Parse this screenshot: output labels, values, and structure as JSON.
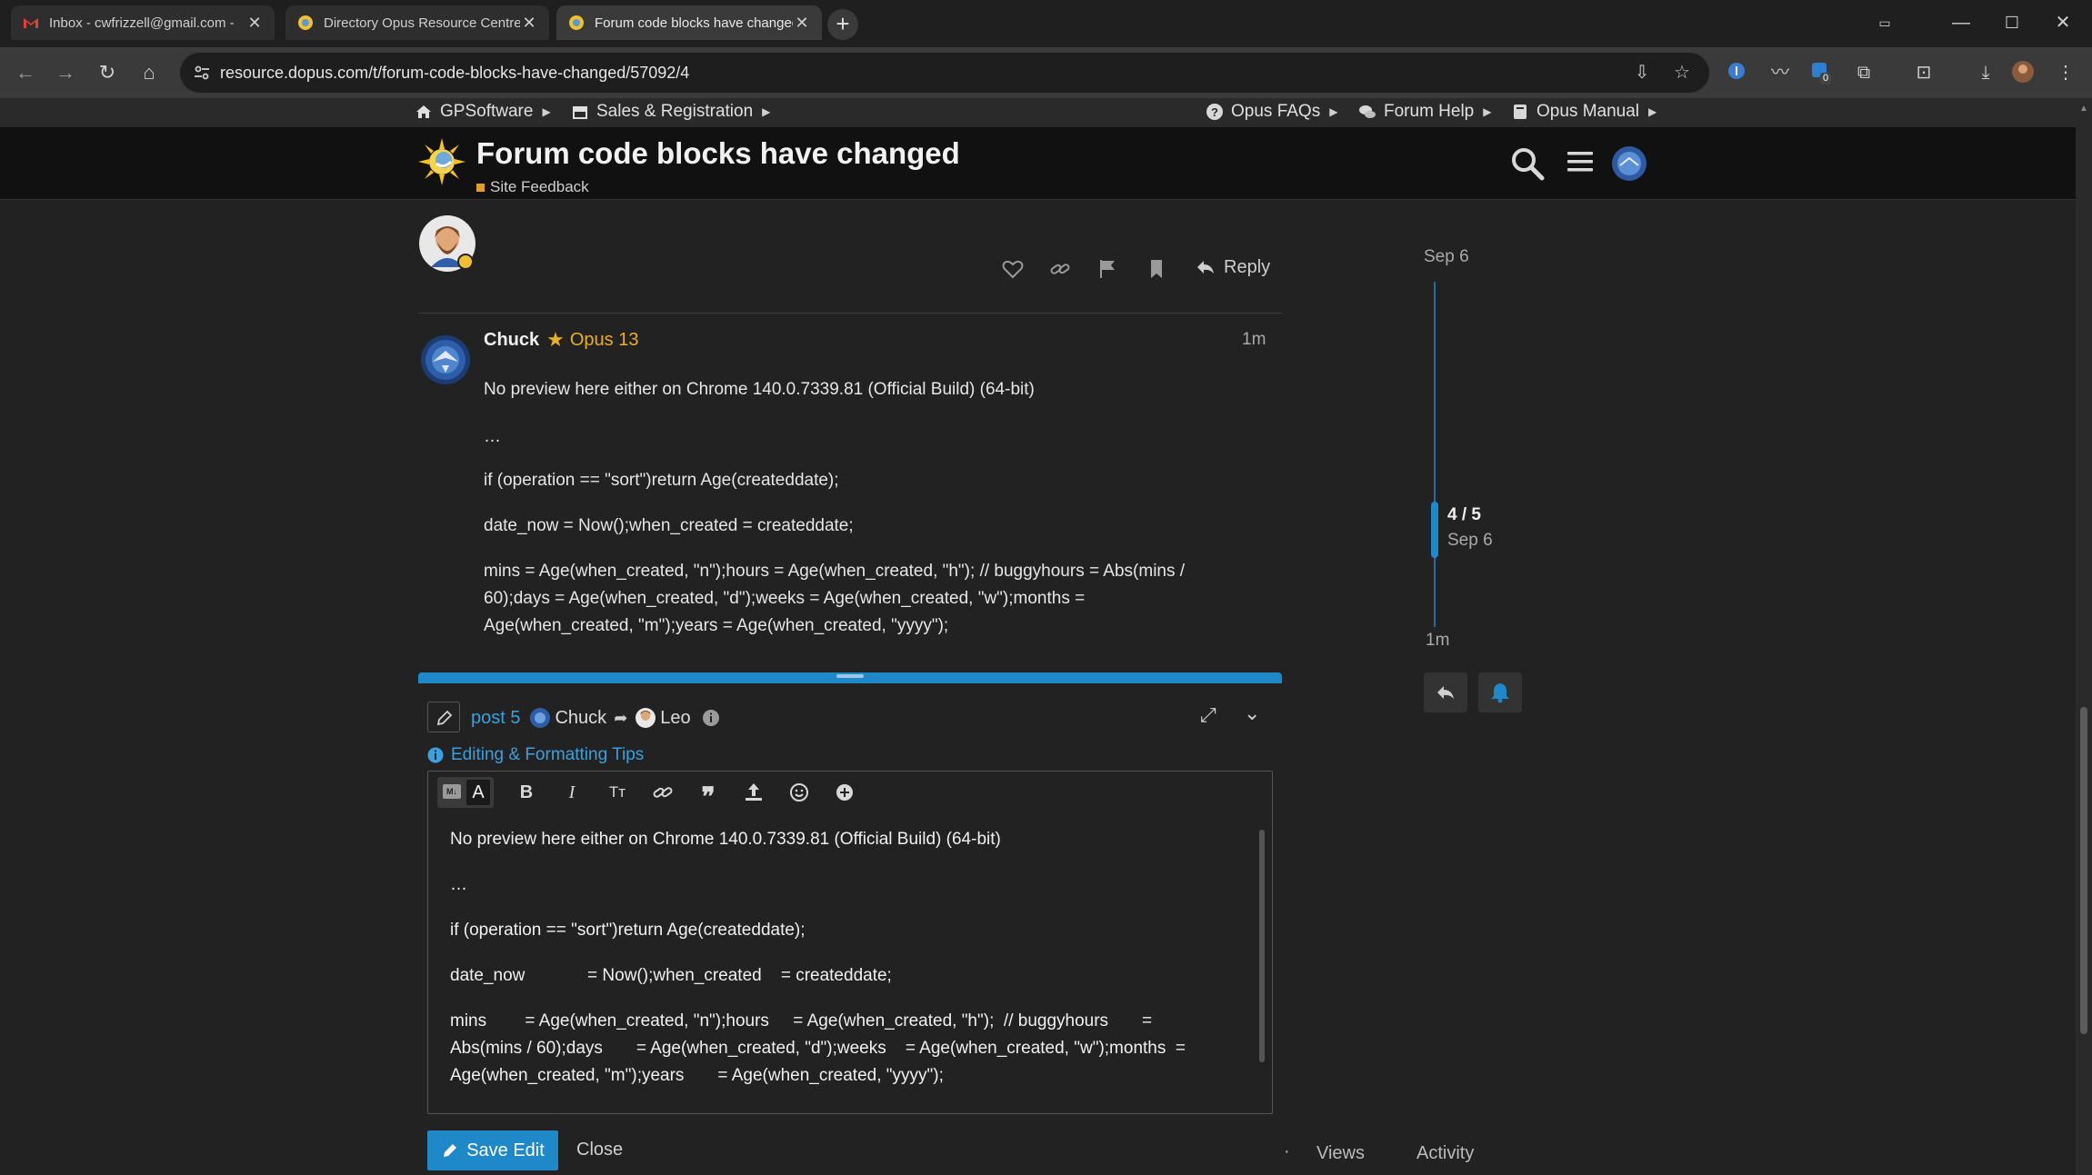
{
  "browser": {
    "tabs": [
      {
        "title": "Inbox - cwfrizzell@gmail.com -",
        "icon": "gmail-icon",
        "active": false
      },
      {
        "title": "Directory Opus Resource Centre",
        "icon": "opus-icon",
        "active": false
      },
      {
        "title": "Forum code blocks have changed",
        "icon": "opus-icon",
        "active": true
      }
    ],
    "url": "resource.dopus.com/t/forum-code-blocks-have-changed/57092/4",
    "extension_badge": "0"
  },
  "site_nav": {
    "left": [
      {
        "label": "GPSoftware",
        "icon": "home-icon"
      },
      {
        "label": "Sales & Registration",
        "icon": "store-icon"
      }
    ],
    "right": [
      {
        "label": "Opus FAQs",
        "icon": "question-circle-icon"
      },
      {
        "label": "Forum Help",
        "icon": "comments-icon"
      },
      {
        "label": "Opus Manual",
        "icon": "book-icon"
      }
    ]
  },
  "topic": {
    "title": "Forum code blocks have changed",
    "category": "Site Feedback",
    "category_color": "#e0a020"
  },
  "prev_post": {
    "reply_label": "Reply"
  },
  "post": {
    "author": "Chuck",
    "badge": "Opus 13",
    "time": "1m",
    "lines": [
      "No preview here either on Chrome 140.0.7339.81 (Official Build) (64-bit)",
      "…",
      "if (operation == \"sort\")return Age(createddate);",
      "date_now = Now();when_created = createddate;",
      "mins = Age(when_created, \"n\");hours = Age(when_created, \"h\"); // buggyhours = Abs(mins /",
      "60);days = Age(when_created, \"d\");weeks = Age(when_created, \"w\");months =",
      "Age(when_created, \"m\");years = Age(when_created, \"yyyy\");"
    ]
  },
  "composer": {
    "post_label": "post 5",
    "reply_to": "Chuck",
    "reply_target": "Leo",
    "tips_label": "Editing & Formatting Tips",
    "editor_lines": [
      "No preview here either on Chrome 140.0.7339.81 (Official Build) (64-bit)",
      "…",
      "if (operation == \"sort\")return Age(createddate);",
      "date_now             = Now();when_created    = createddate;",
      "mins        = Age(when_created, \"n\");hours     = Age(when_created, \"h\");  // buggyhours       =",
      "Abs(mins / 60);days       = Age(when_created, \"d\");weeks    = Age(when_created, \"w\");months  =",
      "Age(when_created, \"m\");years       = Age(when_created, \"yyyy\");"
    ],
    "save_label": "Save Edit",
    "close_label": "Close"
  },
  "timeline": {
    "start_date": "Sep 6",
    "progress": "4 / 5",
    "progress_date": "Sep 6",
    "end_label": "1m"
  },
  "footer_tabs": {
    "views": "Views",
    "activity": "Activity"
  },
  "colors": {
    "accent": "#1e88c8",
    "badge": "#e8b020",
    "background": "#222222"
  }
}
